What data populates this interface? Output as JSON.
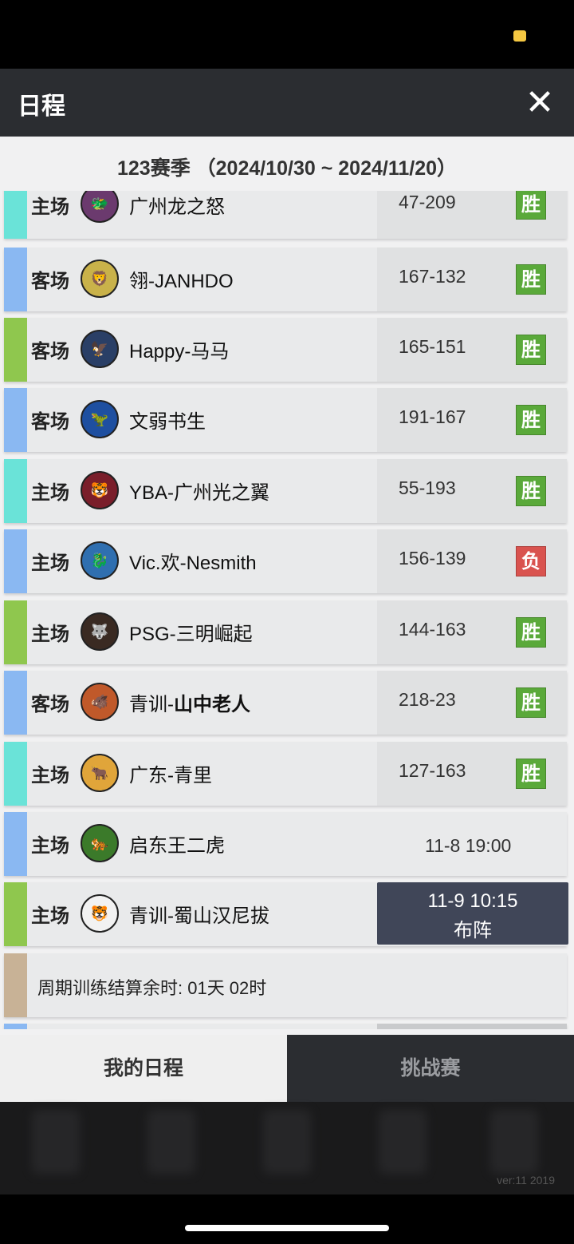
{
  "header": {
    "title": "日程",
    "close_icon": "close-icon"
  },
  "season": {
    "title": "123赛季 （2024/10/30 ~ 2024/11/20）"
  },
  "colors": {
    "teal": "#6ae3d8",
    "blue": "#8ab8f2",
    "green": "#8fc74e",
    "tan": "#c8b296",
    "win": "#5aa93a",
    "loss": "#d9534f"
  },
  "matches": [
    {
      "venue": "主场",
      "team": "广州龙之怒",
      "score": "47-209",
      "result": "胜"
    },
    {
      "venue": "客场",
      "team": "翎-JANHDO",
      "score": "167-132",
      "result": "胜"
    },
    {
      "venue": "客场",
      "team": "Happy-马马",
      "score": "165-151",
      "result": "胜"
    },
    {
      "venue": "客场",
      "team": "文弱书生",
      "score": "191-167",
      "result": "胜"
    },
    {
      "venue": "主场",
      "team": "YBA-广州光之翼",
      "score": "55-193",
      "result": "胜"
    },
    {
      "venue": "主场",
      "team": "Vic.欢-Nesmith",
      "score": "156-139",
      "result": "负"
    },
    {
      "venue": "主场",
      "team": "PSG-三明崛起",
      "score": "144-163",
      "result": "胜"
    },
    {
      "venue": "客场",
      "team_prefix": "青训-",
      "team_bold": "山中老人",
      "score": "218-23",
      "result": "胜"
    },
    {
      "venue": "主场",
      "team": "广东-青里",
      "score": "127-163",
      "result": "胜"
    },
    {
      "venue": "主场",
      "team": "启东王二虎",
      "time": "11-8 19:00"
    },
    {
      "venue": "主场",
      "team": "青训-蜀山汉尼拔",
      "time": "11-9 10:15",
      "action": "布阵"
    }
  ],
  "training": {
    "message": "周期训练结算余时: 01天 02时"
  },
  "tabs": {
    "mine": "我的日程",
    "challenge": "挑战赛"
  },
  "footer": {
    "version": "ver:11  2019"
  }
}
